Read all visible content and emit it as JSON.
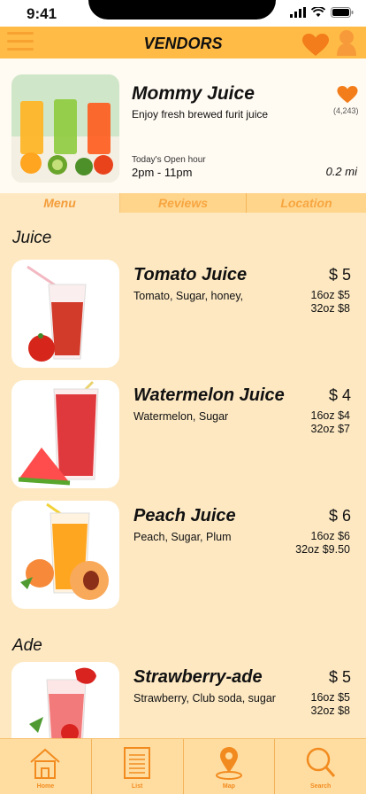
{
  "status_bar": {
    "time": "9:41"
  },
  "header": {
    "title": "VENDORS"
  },
  "vendor": {
    "name": "Mommy Juice",
    "description": "Enjoy fresh brewed furit juice",
    "likes": "(4,243)",
    "hours_label": "Today's Open hour",
    "hours": "2pm - 11pm",
    "distance": "0.2 mi"
  },
  "tabs": [
    {
      "label": "Menu"
    },
    {
      "label": "Reviews"
    },
    {
      "label": "Location"
    }
  ],
  "sections": {
    "juice": {
      "title": "Juice",
      "items": [
        {
          "name": "Tomato Juice",
          "price": "$ 5",
          "ingredients": "Tomato, Sugar, honey,",
          "size1": "16oz $5",
          "size2": "32oz $8"
        },
        {
          "name": "Watermelon Juice",
          "price": "$ 4",
          "ingredients": "Watermelon, Sugar",
          "size1": "16oz $4",
          "size2": "32oz $7"
        },
        {
          "name": "Peach Juice",
          "price": "$ 6",
          "ingredients": "Peach, Sugar, Plum",
          "size1": "16oz $6",
          "size2": "32oz $9.50"
        }
      ]
    },
    "ade": {
      "title": "Ade",
      "items": [
        {
          "name": "Strawberry-ade",
          "price": "$ 5",
          "ingredients": "Strawberry, Club soda, sugar",
          "size1": "16oz $5",
          "size2": "32oz $8"
        }
      ]
    }
  },
  "bottom_nav": [
    {
      "label": "Home",
      "icon": "home-icon"
    },
    {
      "label": "List",
      "icon": "list-icon"
    },
    {
      "label": "Map",
      "icon": "map-pin-icon"
    },
    {
      "label": "Search",
      "icon": "search-icon"
    }
  ],
  "colors": {
    "accent": "#ffbb45",
    "brand_orange": "#f27d1a",
    "background": "#fde8c2"
  }
}
